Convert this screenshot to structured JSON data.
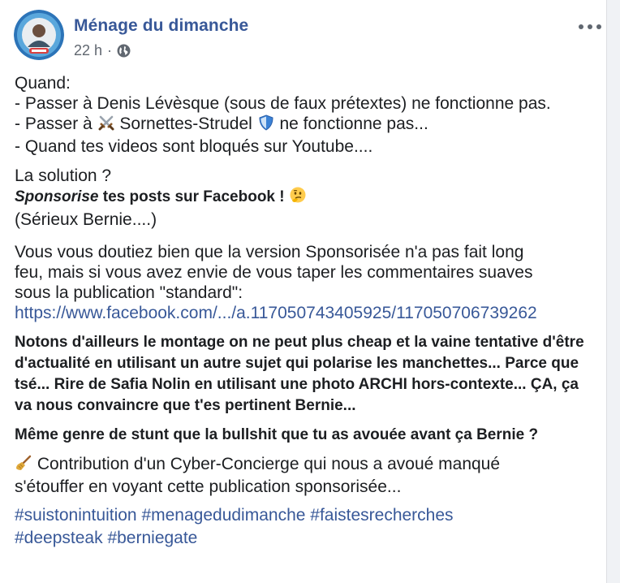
{
  "post": {
    "page_name": "Ménage du dimanche",
    "time": "22 h",
    "separator": "·",
    "privacy_icon": "globe-icon",
    "intro": {
      "l1": "Quand:",
      "l2": "- Passer à Denis Lévèsque (sous de faux prétextes) ne fonctionne pas.",
      "l3_a": "- Passer à ",
      "l3_b": " Sornettes-Strudel ",
      "l3_c": " ne fonctionne pas...",
      "l4": "- Quand tes videos sont bloqués sur Youtube...."
    },
    "solution": {
      "l1": "La solution ?",
      "l2_em": "Sponsorise",
      "l2_rest": " tes posts sur Facebook ! ",
      "l3": "(Sérieux Bernie....)"
    },
    "p3": {
      "l1": "Vous vous doutiez bien que la version Sponsorisée n'a pas fait long",
      "l2": "feu, mais si vous avez envie de vous taper les commentaires suaves",
      "l3": "sous la publication \"standard\":",
      "link": "https://www.facebook.com/.../a.117050743405925/117050706739262"
    },
    "p4": {
      "l1": "Notons d'ailleurs le montage on ne peut plus cheap et la vaine tentative d'être",
      "l2": "d'actualité en utilisant un autre sujet qui polarise les manchettes... Parce que",
      "l3": "tsé... Rire de Safia Nolin en utilisant une photo ARCHI hors-contexte... ÇA, ça",
      "l4": "va nous convaincre que t'es pertinent Bernie..."
    },
    "p5": {
      "l1": "Même genre de stunt que la bullshit que tu as avouée avant ça Bernie ?"
    },
    "p6": {
      "l1": " Contribution d'un Cyber-Concierge qui nous a avoué manqué",
      "l2": "s'étouffer en voyant cette publication sponsorisée..."
    },
    "hashtags": [
      "#suistonintuition",
      "#menagedudimanche",
      "#faistesrecherches",
      "#deepsteak",
      "#berniegate"
    ],
    "emoji_icons": [
      "crossed-swords-icon",
      "shield-icon",
      "thinking-face-icon",
      "broom-icon"
    ],
    "colors": {
      "link": "#385898",
      "text": "#1c1e21",
      "meta": "#606770"
    }
  }
}
